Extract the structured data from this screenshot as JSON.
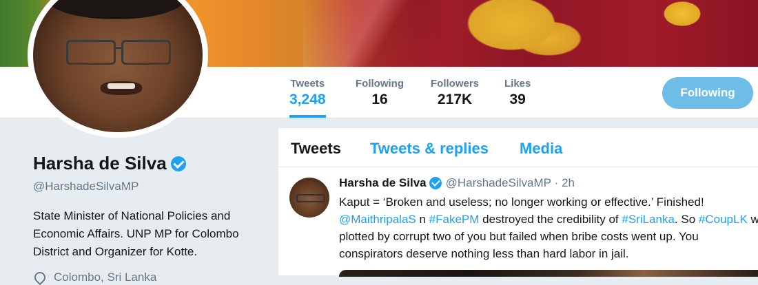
{
  "profile": {
    "name": "Harsha de Silva",
    "handle": "@HarshadeSilvaMP",
    "bio": "State Minister of National Policies and\nEconomic Affairs. UNP MP for Colombo\nDistrict and Organizer for Kotte.",
    "location": "Colombo, Sri Lanka"
  },
  "stats": [
    {
      "label": "Tweets",
      "value": "3,248"
    },
    {
      "label": "Following",
      "value": "16"
    },
    {
      "label": "Followers",
      "value": "217K"
    },
    {
      "label": "Likes",
      "value": "39"
    }
  ],
  "follow_button": "Following",
  "tabs": [
    "Tweets",
    "Tweets & replies",
    "Media"
  ],
  "tweet": {
    "name": "Harsha de Silva",
    "handle": "@HarshadeSilvaMP",
    "time": "2h",
    "line1": "Kaput = ‘Broken and useless; no longer working or effective.’ Finished!",
    "mention": "@MaithripalaS",
    "seg1": " n ",
    "tag1": "#FakePM",
    "seg2": " destroyed the credibility of ",
    "tag2": "#SriLanka",
    "seg3": ". So ",
    "tag3": "#CoupLK",
    "seg4": " w",
    "line3": "plotted by corrupt two of you but failed when bribe costs went up. You",
    "line4": "conspirators deserve nothing less than hard labor in jail."
  },
  "colors": {
    "accent": "#1da1f2",
    "muted": "#657786",
    "page_bg": "#e6ecf0"
  },
  "icons": {
    "verified": "verified-badge-icon",
    "location": "location-pin-icon"
  }
}
